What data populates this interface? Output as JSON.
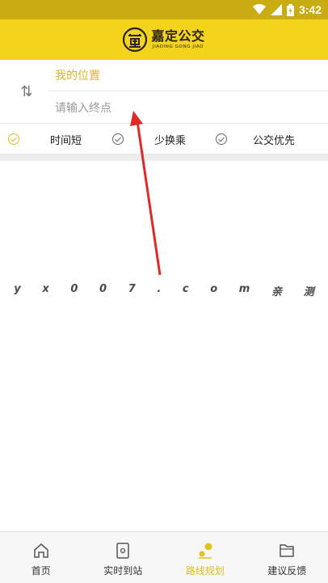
{
  "status_bar": {
    "time": "3:42",
    "icons": [
      "wifi-icon",
      "signal-icon",
      "battery-icon"
    ]
  },
  "header": {
    "logo_cn": "嘉定公交",
    "logo_en": "JIADING GONG JIAO",
    "logo_icon": "jiading-seal-icon"
  },
  "route": {
    "swap_icon_text": "⇅",
    "from_value": "我的位置",
    "to_placeholder": "请输入终点"
  },
  "options": [
    {
      "label": "时间短",
      "selected": true
    },
    {
      "label": "少换乘",
      "selected": false
    },
    {
      "label": "公交优先",
      "selected": false
    }
  ],
  "watermark": [
    "y",
    "x",
    "0",
    "0",
    "7",
    ".",
    "c",
    "o",
    "m",
    "亲",
    "测"
  ],
  "bottom_nav": [
    {
      "label": "首页",
      "icon": "home-icon",
      "active": false
    },
    {
      "label": "实时到站",
      "icon": "realtime-icon",
      "active": false
    },
    {
      "label": "路线规划",
      "icon": "route-plan-icon",
      "active": true
    },
    {
      "label": "建议反馈",
      "icon": "feedback-icon",
      "active": false
    }
  ],
  "colors": {
    "brand_yellow": "#f3d31b",
    "status_bar": "#c9ac12",
    "accent_gold": "#e0b521",
    "annotation_red": "#e02a2a"
  }
}
